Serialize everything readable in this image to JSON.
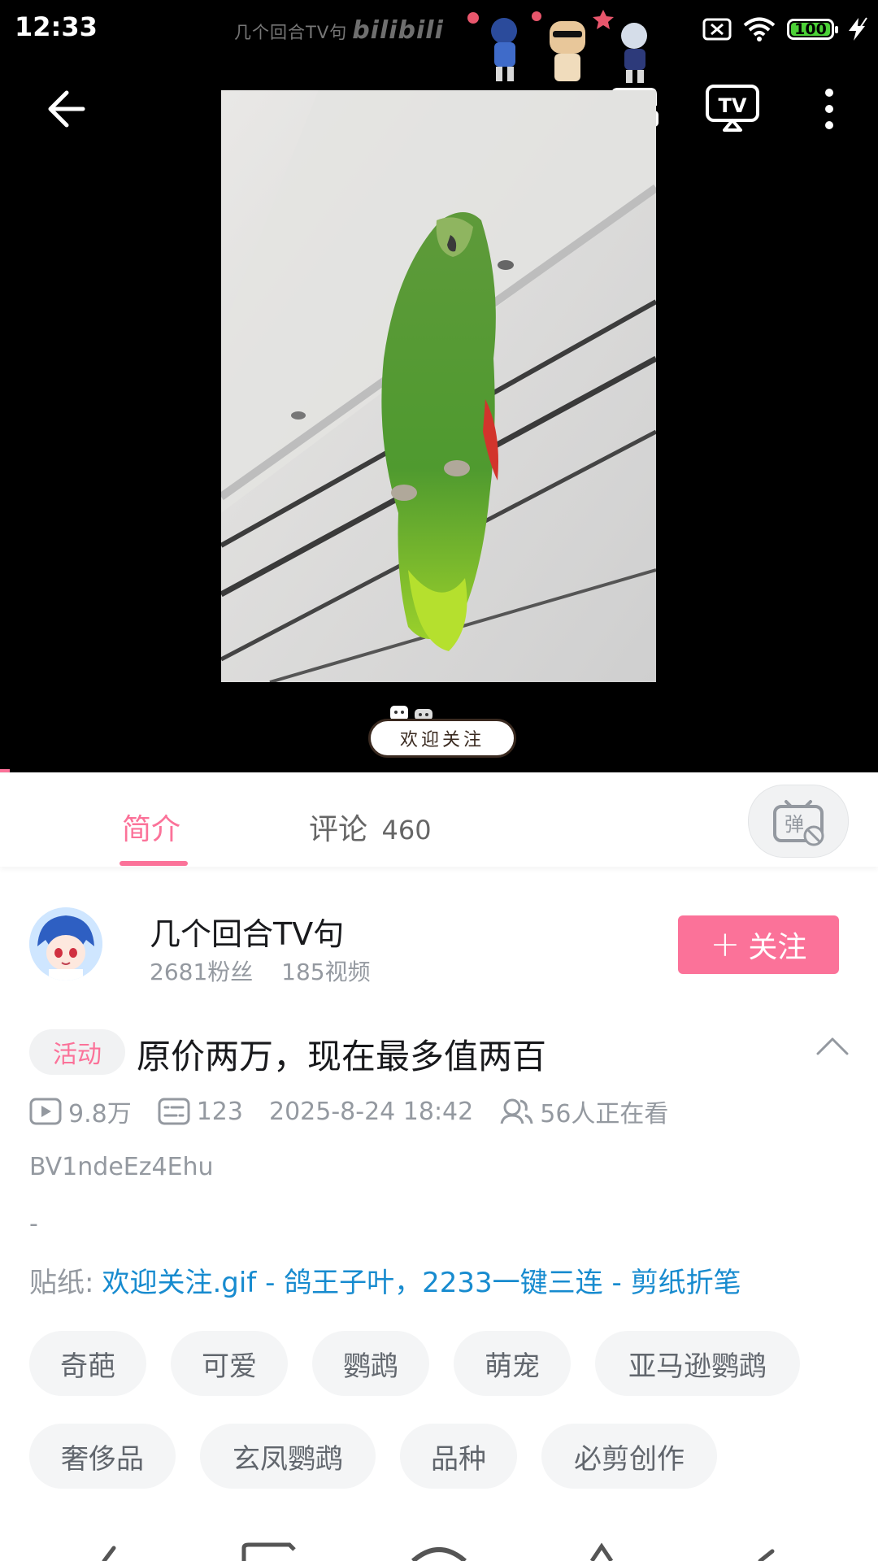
{
  "status_bar": {
    "time": "12:33",
    "watermark_text": "几个回合TV句",
    "watermark_logo": "bilibili",
    "battery": "100"
  },
  "player": {
    "welcome_sticker": "欢迎关注",
    "icons": [
      "back-arrow-icon",
      "picture-in-picture-icon",
      "tv-cast-icon",
      "more-vertical-icon"
    ]
  },
  "tabs": {
    "intro": "简介",
    "comments": "评论",
    "comments_count": "460"
  },
  "uploader": {
    "name": "几个回合TV句",
    "followers": "2681粉丝",
    "videos": "185视频",
    "follow_label": "关注"
  },
  "video": {
    "activity_tag": "活动",
    "title": "原价两万，现在最多值两百",
    "views": "9.8万",
    "danmaku": "123",
    "date": "2025-8-24 18:42",
    "watching": "56人正在看",
    "bvid": "BV1ndeEz4Ehu",
    "description": "-",
    "stickers_label": "贴纸:",
    "stickers_value": "欢迎关注.gif - 鸽王子叶，2233一键三连 - 剪纸折笔"
  },
  "tags": [
    "奇葩",
    "可爱",
    "鹦鹉",
    "萌宠",
    "亚马逊鹦鹉",
    "奢侈品",
    "玄凤鹦鹉",
    "品种",
    "必剪创作"
  ],
  "colors": {
    "accent": "#fb7299",
    "link": "#178bcf",
    "muted": "#9499a0"
  }
}
